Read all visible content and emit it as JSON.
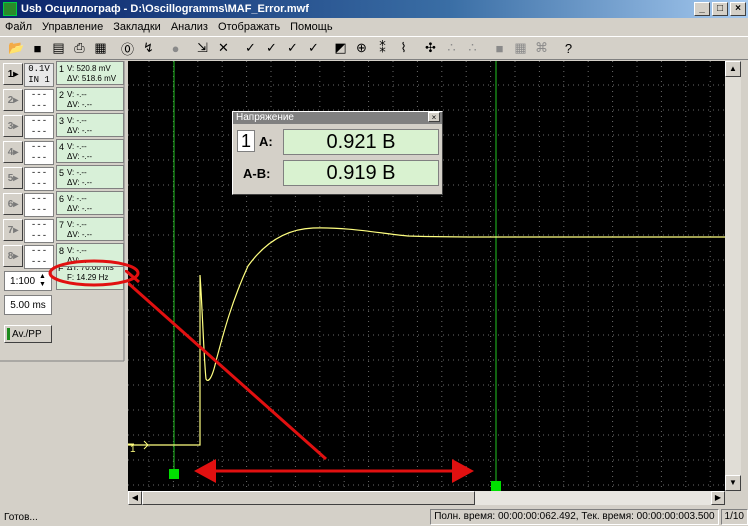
{
  "window": {
    "title": "Usb Осциллограф - D:\\Oscillogramms\\MAF_Error.mwf",
    "min": "_",
    "max": "□",
    "close": "×"
  },
  "menu": [
    "Файл",
    "Управление",
    "Закладки",
    "Анализ",
    "Отображать",
    "Помощь"
  ],
  "toolbar": [
    {
      "icon": "open-folder-icon",
      "glyph": "📂"
    },
    {
      "icon": "save-disk-icon",
      "glyph": "■"
    },
    {
      "icon": "export-icon",
      "glyph": "▤"
    },
    {
      "icon": "print-icon",
      "glyph": "⎙"
    },
    {
      "icon": "preview-icon",
      "glyph": "▦"
    },
    {
      "icon": "sep"
    },
    {
      "icon": "stop-icon",
      "glyph": "⓪"
    },
    {
      "icon": "record-icon",
      "glyph": "↯"
    },
    {
      "icon": "sep"
    },
    {
      "icon": "circle-icon",
      "glyph": "●",
      "grey": true
    },
    {
      "icon": "sep"
    },
    {
      "icon": "cursor-icon",
      "glyph": "⇲"
    },
    {
      "icon": "tools-icon",
      "glyph": "✕"
    },
    {
      "icon": "sep"
    },
    {
      "icon": "check-icon",
      "glyph": "✓"
    },
    {
      "icon": "check-a-icon",
      "glyph": "✓"
    },
    {
      "icon": "check-b-icon",
      "glyph": "✓"
    },
    {
      "icon": "check-c-icon",
      "glyph": "✓"
    },
    {
      "icon": "sep"
    },
    {
      "icon": "contrast-icon",
      "glyph": "◩"
    },
    {
      "icon": "zoom-icon",
      "glyph": "⊕"
    },
    {
      "icon": "marker-icon",
      "glyph": "⁑"
    },
    {
      "icon": "spectrum-icon",
      "glyph": "⌇"
    },
    {
      "icon": "sep"
    },
    {
      "icon": "abc-icon",
      "glyph": "✣"
    },
    {
      "icon": "abc2-icon",
      "glyph": "∴",
      "grey": true
    },
    {
      "icon": "abc3-icon",
      "glyph": "∴",
      "grey": true
    },
    {
      "icon": "sep"
    },
    {
      "icon": "grid1-icon",
      "glyph": "■",
      "grey": true
    },
    {
      "icon": "grid2-icon",
      "glyph": "▦",
      "grey": true
    },
    {
      "icon": "grid3-icon",
      "glyph": "⌘",
      "grey": true
    },
    {
      "icon": "sep"
    },
    {
      "icon": "help-icon",
      "glyph": "?"
    }
  ],
  "channels": [
    {
      "btn": "1▸",
      "top": "0.1V",
      "bot": "IN 1",
      "active": true,
      "num": "1",
      "r1": "V: 520.8 mV",
      "r2": "ΔV: 518.6 mV"
    },
    {
      "btn": "2▸",
      "top": "---",
      "bot": "---",
      "active": false,
      "num": "2",
      "r1": "V:  -.--",
      "r2": "ΔV: -.--"
    },
    {
      "btn": "3▸",
      "top": "---",
      "bot": "---",
      "active": false,
      "num": "3",
      "r1": "V:  -.--",
      "r2": "ΔV: -.--"
    },
    {
      "btn": "4▸",
      "top": "---",
      "bot": "---",
      "active": false,
      "num": "4",
      "r1": "V:  -.--",
      "r2": "ΔV: -.--"
    },
    {
      "btn": "5▸",
      "top": "---",
      "bot": "---",
      "active": false,
      "num": "5",
      "r1": "V:  -.--",
      "r2": "ΔV: -.--"
    },
    {
      "btn": "6▸",
      "top": "---",
      "bot": "---",
      "active": false,
      "num": "6",
      "r1": "V:  -.--",
      "r2": "ΔV: -.--"
    },
    {
      "btn": "7▸",
      "top": "---",
      "bot": "---",
      "active": false,
      "num": "7",
      "r1": "V:  -.--",
      "r2": "ΔV: -.--"
    },
    {
      "btn": "8▸",
      "top": "---",
      "bot": "---",
      "active": false,
      "num": "8",
      "r1": "V:  -.--",
      "r2": "ΔV: -.--"
    }
  ],
  "time_meas": {
    "dt": "ΔT: 70.00 ms",
    "f": "F: 14.29 Hz"
  },
  "scale": {
    "ratio": "1:100",
    "timebase": "5.00 ms",
    "av_pp": "Av./PP"
  },
  "voltage_window": {
    "caption": "Напряжение",
    "channel": "1",
    "a_label": "A:",
    "a_value": "0.921 В",
    "ab_label": "A-B:",
    "ab_value": "0.919 В"
  },
  "trigger_label": "1",
  "status": {
    "left": "Готов...",
    "times": "Полн. время: 00:00:00:062.492, Тек. время: 00:00:00:003.500",
    "page": "1/10"
  },
  "colors": {
    "trace": "#ffff80",
    "cursor": "#22c322",
    "annotation": "#e11010",
    "grid": "#6a6a6a"
  }
}
